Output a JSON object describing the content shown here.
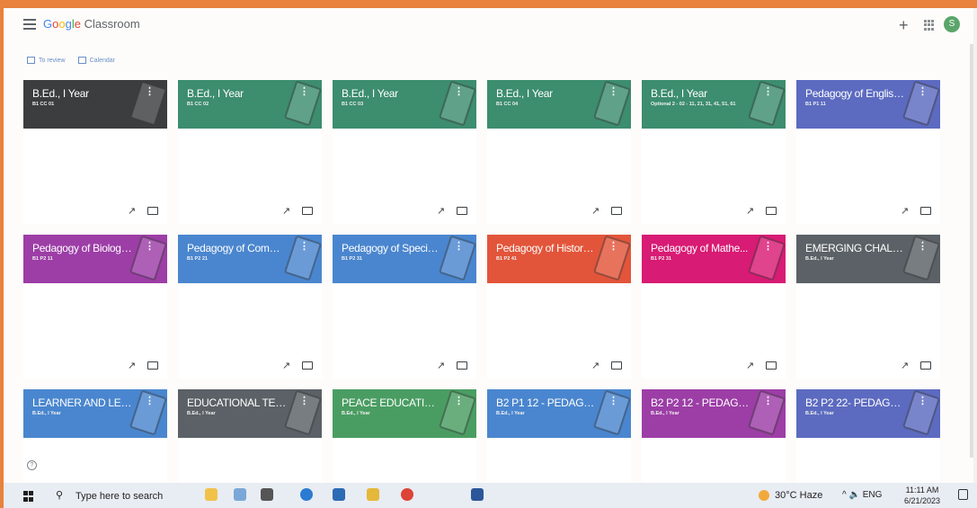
{
  "app": {
    "brand_part1": "G",
    "brand_part2": "o",
    "brand_part3": "o",
    "brand_part4": "g",
    "brand_part5": "l",
    "brand_part6": "e",
    "brand_rest": " Classroom",
    "avatar_letter": "S"
  },
  "subnav": {
    "to_review": "To review",
    "calendar": "Calendar"
  },
  "colors": {
    "accent_frame": "#e8823c",
    "dark_card": "#3b3d3f",
    "green_card": "#3d8d6f",
    "indigo_card": "#5c6bc0",
    "purple_card": "#9c3ea6",
    "blue_card": "#4a86cf",
    "red_card": "#e2553a",
    "pink_card": "#d81b74",
    "grey_card": "#5b6166",
    "teal_card": "#4a9d62"
  },
  "cards": [
    {
      "title": "B.Ed., I Year",
      "sub": "B1 CC 01",
      "color": "#3b3d3f",
      "icon": "gold-coins-illustration"
    },
    {
      "title": "B.Ed., I Year",
      "sub": "B1 CC 02",
      "color": "#3d8d6f",
      "icon": "tablet-illustration"
    },
    {
      "title": "B.Ed., I Year",
      "sub": "B1 CC 03",
      "color": "#3d8d6f",
      "icon": "tablet-illustration"
    },
    {
      "title": "B.Ed., I Year",
      "sub": "B1 CC 04",
      "color": "#3d8d6f",
      "icon": "tablet-illustration"
    },
    {
      "title": "B.Ed., I Year",
      "sub": "Optional 2 - 02 - 11, 21, 31, 41, 51, 61",
      "color": "#3d8d6f",
      "icon": "tablet-illustration"
    },
    {
      "title": "Pedagogy of English...",
      "sub": "B1 P1 11",
      "color": "#5c6bc0",
      "icon": "books-illustration"
    },
    {
      "title": "Pedagogy of Biologic...",
      "sub": "B1 P2 11",
      "color": "#9c3ea6",
      "icon": "flask-illustration"
    },
    {
      "title": "Pedagogy of Comme...",
      "sub": "B1 P2 21",
      "color": "#4a86cf",
      "icon": "pencil-illustration"
    },
    {
      "title": "Pedagogy of Special ...",
      "sub": "B1 P2 31",
      "color": "#4a86cf",
      "icon": "microscope-illustration"
    },
    {
      "title": "Pedagogy of History ...",
      "sub": "B1 P2 41",
      "color": "#e2553a",
      "icon": "globe-illustration"
    },
    {
      "title": "Pedagogy of Mathe...",
      "sub": "B1 P2 31",
      "color": "#d81b74",
      "icon": "triangle-ruler-illustration"
    },
    {
      "title": "EMERGING CHALLE...",
      "sub": "B.Ed., I Year",
      "color": "#5b6166",
      "icon": "laptop-illustration"
    },
    {
      "title": "LEARNER AND LEAR...",
      "sub": "B.Ed., I Year",
      "color": "#4a86cf",
      "icon": "pencil-illustration"
    },
    {
      "title": "EDUCATIONAL TECH...",
      "sub": "B.Ed., I Year",
      "color": "#5b6166",
      "icon": "laptop-illustration"
    },
    {
      "title": "PEACE EDUCATION-...",
      "sub": "B.Ed., I Year",
      "color": "#4a9d62",
      "icon": "notebook-illustration"
    },
    {
      "title": "B2 P1 12 - PEDAGOG...",
      "sub": "B.Ed., I Year",
      "color": "#4a86cf",
      "icon": "microscope-illustration"
    },
    {
      "title": "B2 P2 12 - PEDAGOG...",
      "sub": "B.Ed., I Year",
      "color": "#9c3ea6",
      "icon": "flask-illustration"
    },
    {
      "title": "B2 P2 22- PEDAGOG...",
      "sub": "B.Ed., I Year",
      "color": "#5c6bc0",
      "icon": "ruler-illustration"
    }
  ],
  "taskbar": {
    "search_placeholder": "Type here to search",
    "weather": "30°C  Haze",
    "lang": "ENG",
    "time": "11:11 AM",
    "date": "6/21/2023"
  }
}
